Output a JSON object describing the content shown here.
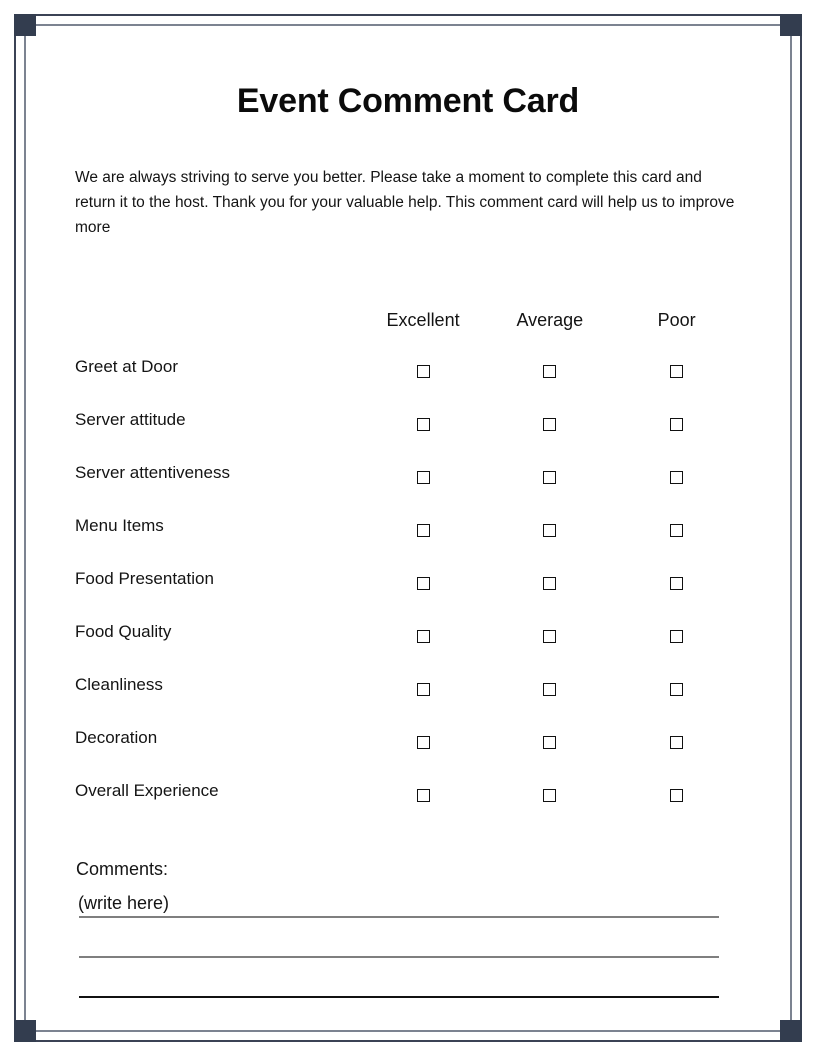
{
  "document": {
    "title": "Event Comment Card",
    "intro": "We are always striving to serve you better. Please take a moment to complete this card and return it to the host. Thank you for your valuable help. This comment card will help us to improve more"
  },
  "theme": {
    "frame_color": "#3b4355",
    "frame_inner_color": "#7c8391",
    "corner_block_color": "#333d4f",
    "text_color": "#141414",
    "checkbox_border": "#111111",
    "line_gray": "#7f7f7f",
    "line_dark": "#111111"
  },
  "rating_table": {
    "row_header_label": "",
    "columns": [
      "Excellent",
      "Average",
      "Poor"
    ],
    "rows": [
      {
        "label": "Greet at Door",
        "checked": [
          false,
          false,
          false
        ]
      },
      {
        "label": "Server attitude",
        "checked": [
          false,
          false,
          false
        ]
      },
      {
        "label": "Server attentiveness",
        "checked": [
          false,
          false,
          false
        ]
      },
      {
        "label": "Menu Items",
        "checked": [
          false,
          false,
          false
        ]
      },
      {
        "label": "Food Presentation",
        "checked": [
          false,
          false,
          false
        ]
      },
      {
        "label": "Food Quality",
        "checked": [
          false,
          false,
          false
        ]
      },
      {
        "label": "Cleanliness",
        "checked": [
          false,
          false,
          false
        ]
      },
      {
        "label": "Decoration",
        "checked": [
          false,
          false,
          false
        ]
      },
      {
        "label": "Overall Experience",
        "checked": [
          false,
          false,
          false
        ]
      }
    ]
  },
  "comments": {
    "label": "Comments:",
    "hint": "(write here)",
    "line_count": 3
  }
}
